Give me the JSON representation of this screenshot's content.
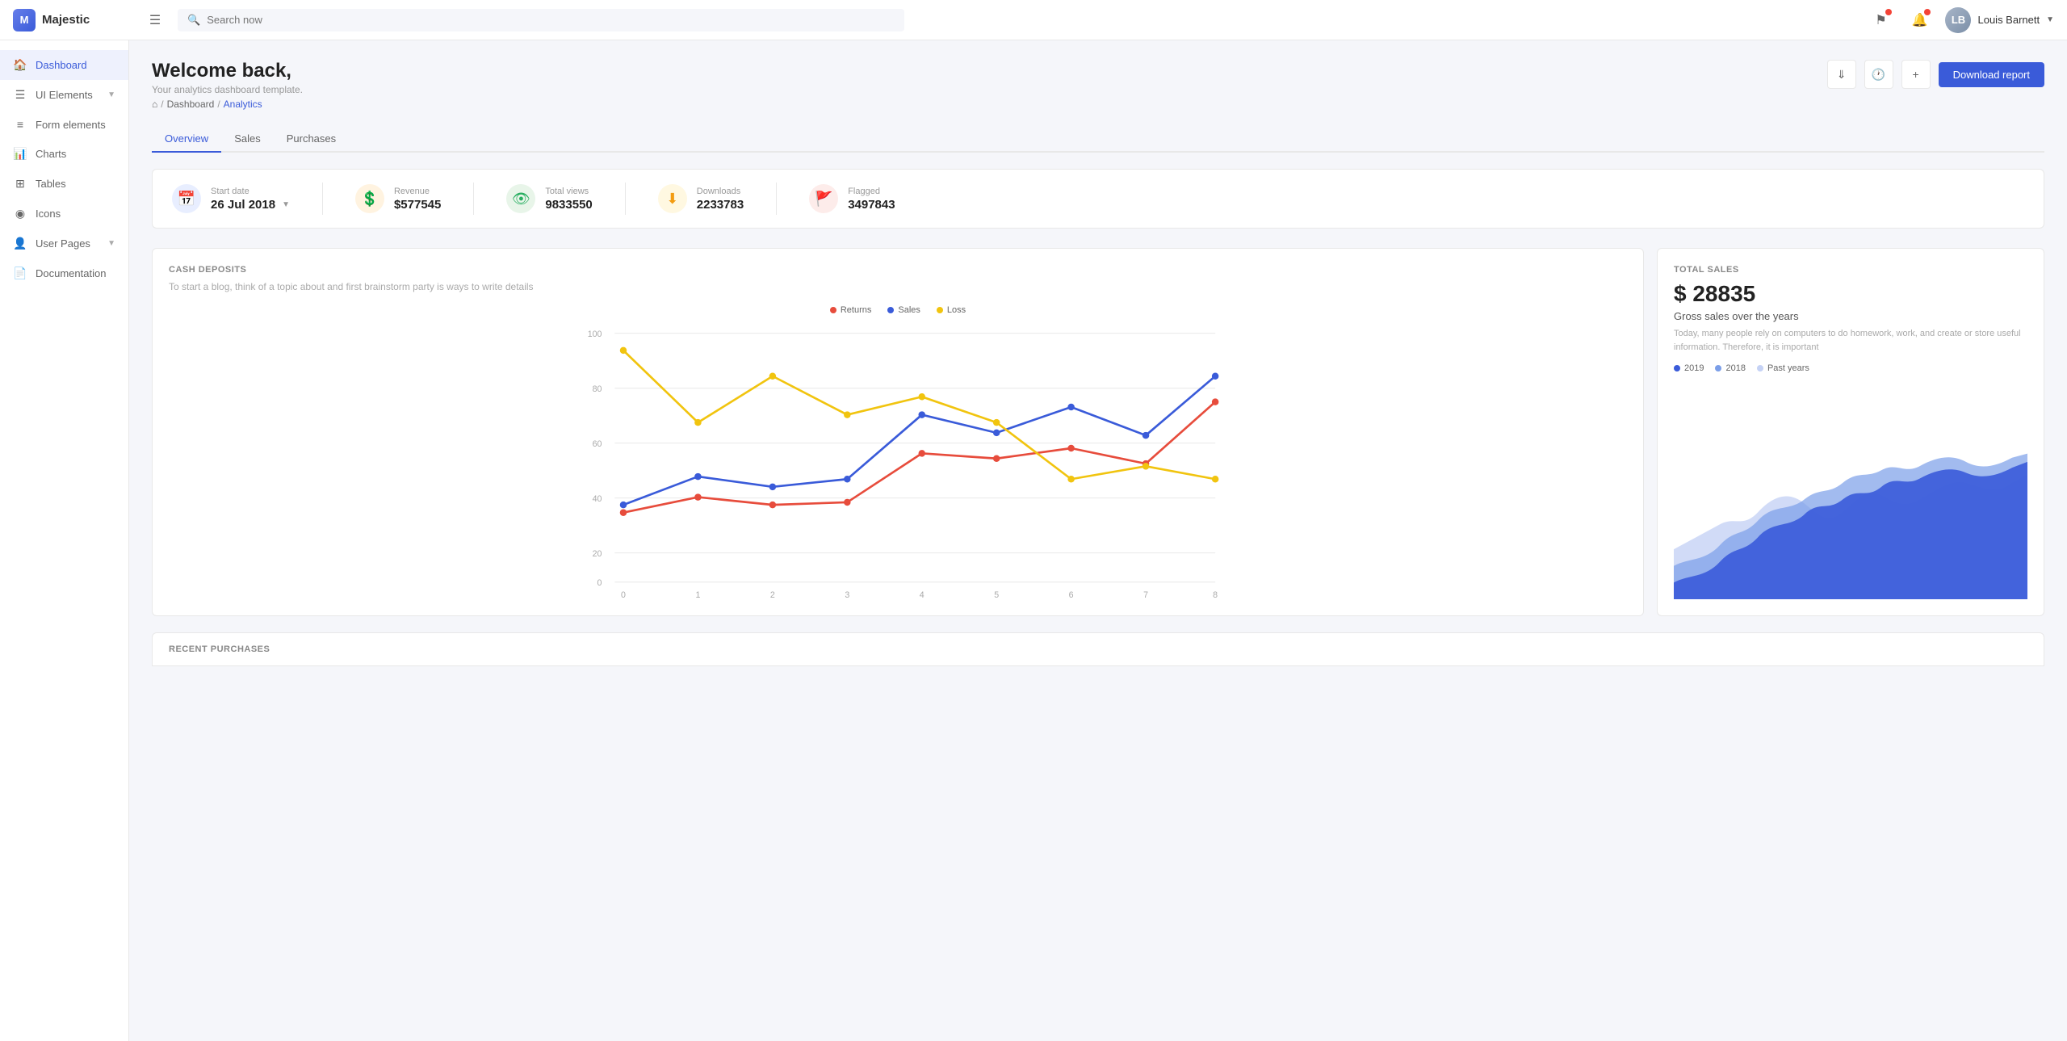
{
  "app": {
    "name": "Majestic",
    "logo_letters": "M"
  },
  "topnav": {
    "search_placeholder": "Search now",
    "user_name": "Louis Barnett",
    "user_initials": "LB"
  },
  "sidebar": {
    "items": [
      {
        "id": "dashboard",
        "label": "Dashboard",
        "icon": "🏠",
        "active": true,
        "has_arrow": false
      },
      {
        "id": "ui-elements",
        "label": "UI Elements",
        "icon": "☰",
        "active": false,
        "has_arrow": true
      },
      {
        "id": "form-elements",
        "label": "Form elements",
        "icon": "≡",
        "active": false,
        "has_arrow": false
      },
      {
        "id": "charts",
        "label": "Charts",
        "icon": "📊",
        "active": false,
        "has_arrow": false
      },
      {
        "id": "tables",
        "label": "Tables",
        "icon": "⊞",
        "active": false,
        "has_arrow": false
      },
      {
        "id": "icons",
        "label": "Icons",
        "icon": "◉",
        "active": false,
        "has_arrow": false
      },
      {
        "id": "user-pages",
        "label": "User Pages",
        "icon": "👤",
        "active": false,
        "has_arrow": true
      },
      {
        "id": "documentation",
        "label": "Documentation",
        "icon": "📄",
        "active": false,
        "has_arrow": false
      }
    ]
  },
  "page": {
    "welcome": "Welcome back,",
    "subtitle": "Your analytics dashboard template.",
    "breadcrumb_home": "⌂",
    "breadcrumb_dashboard": "Dashboard",
    "breadcrumb_analytics": "Analytics"
  },
  "header_actions": {
    "download_icon": "⬇",
    "clock_icon": "🕐",
    "add_icon": "+",
    "download_report": "Download report"
  },
  "tabs": [
    {
      "id": "overview",
      "label": "Overview",
      "active": true
    },
    {
      "id": "sales",
      "label": "Sales",
      "active": false
    },
    {
      "id": "purchases",
      "label": "Purchases",
      "active": false
    }
  ],
  "stats": {
    "start_date_label": "Start date",
    "start_date_value": "26 Jul 2018",
    "revenue_label": "Revenue",
    "revenue_value": "$577545",
    "views_label": "Total views",
    "views_value": "9833550",
    "downloads_label": "Downloads",
    "downloads_value": "2233783",
    "flagged_label": "Flagged",
    "flagged_value": "3497843"
  },
  "cash_deposits": {
    "title": "CASH DEPOSITS",
    "subtitle": "To start a blog, think of a topic about and first brainstorm party is ways to write details",
    "legend": [
      {
        "label": "Returns",
        "color": "#e74c3c"
      },
      {
        "label": "Sales",
        "color": "#3a5bd9"
      },
      {
        "label": "Loss",
        "color": "#f1c40f"
      }
    ],
    "y_labels": [
      "100",
      "80",
      "60",
      "40",
      "20",
      "0"
    ],
    "x_labels": [
      "0",
      "1",
      "2",
      "3",
      "4",
      "5",
      "6",
      "7",
      "8"
    ],
    "series": {
      "returns": [
        27,
        33,
        30,
        31,
        50,
        48,
        52,
        46,
        70
      ],
      "sales": [
        30,
        41,
        37,
        40,
        65,
        58,
        68,
        57,
        80
      ],
      "loss": [
        90,
        62,
        80,
        65,
        72,
        62,
        40,
        45,
        40
      ]
    }
  },
  "total_sales": {
    "label": "TOTAL SALES",
    "value": "$ 28835",
    "subtitle": "Gross sales over the years",
    "description": "Today, many people rely on computers to do homework, work, and create or store useful information. Therefore, it is important",
    "legend": [
      {
        "label": "2019",
        "color": "#3a5bd9"
      },
      {
        "label": "2018",
        "color": "#7b9ee8"
      },
      {
        "label": "Past years",
        "color": "#c5d2f5"
      }
    ]
  },
  "recent_purchases": {
    "title": "RECENT PURCHASES"
  }
}
